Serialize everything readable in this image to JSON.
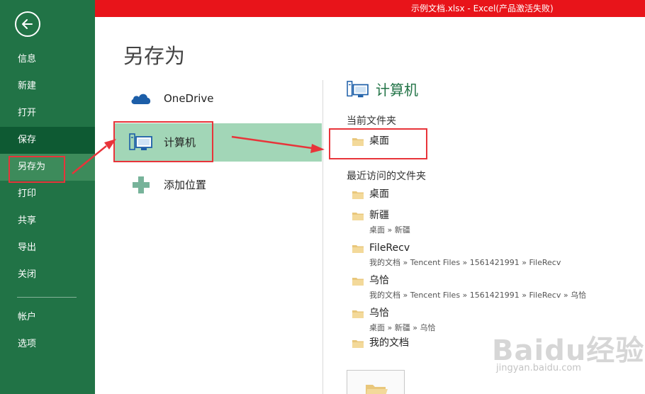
{
  "window": {
    "title": "示例文档.xlsx -  Excel(产品激活失败)"
  },
  "page_title": "另存为",
  "sidebar": {
    "items": [
      {
        "label": "信息"
      },
      {
        "label": "新建"
      },
      {
        "label": "打开"
      },
      {
        "label": "保存"
      },
      {
        "label": "另存为"
      },
      {
        "label": "打印"
      },
      {
        "label": "共享"
      },
      {
        "label": "导出"
      },
      {
        "label": "关闭"
      },
      {
        "label": "帐户"
      },
      {
        "label": "选项"
      }
    ],
    "active_item": "保存",
    "selected_item": "另存为"
  },
  "locations": [
    {
      "label": "OneDrive",
      "icon": "cloud-icon"
    },
    {
      "label": "计算机",
      "icon": "computer-icon"
    },
    {
      "label": "添加位置",
      "icon": "plus-icon"
    }
  ],
  "right_panel": {
    "heading": "计算机",
    "current_folder_label": "当前文件夹",
    "current_folder": {
      "name": "桌面"
    },
    "recent_label": "最近访问的文件夹",
    "recent": [
      {
        "name": "桌面",
        "path": ""
      },
      {
        "name": "新疆",
        "path": "桌面 » 新疆"
      },
      {
        "name": "FileRecv",
        "path": "我的文档 » Tencent Files » 1561421991 » FileRecv"
      },
      {
        "name": "乌恰",
        "path": "我的文档 » Tencent Files » 1561421991 » FileRecv » 乌恰"
      },
      {
        "name": "乌恰",
        "path": "桌面 » 新疆 » 乌恰"
      },
      {
        "name": "我的文档",
        "path": ""
      }
    ]
  },
  "watermark": {
    "brand": "Baidu经验",
    "url": "jingyan.baidu.com"
  },
  "colors": {
    "sidebar": "#217346",
    "titlebar": "#e8141a",
    "selected_location": "#a2d6b7",
    "annotation": "#e8343a"
  }
}
